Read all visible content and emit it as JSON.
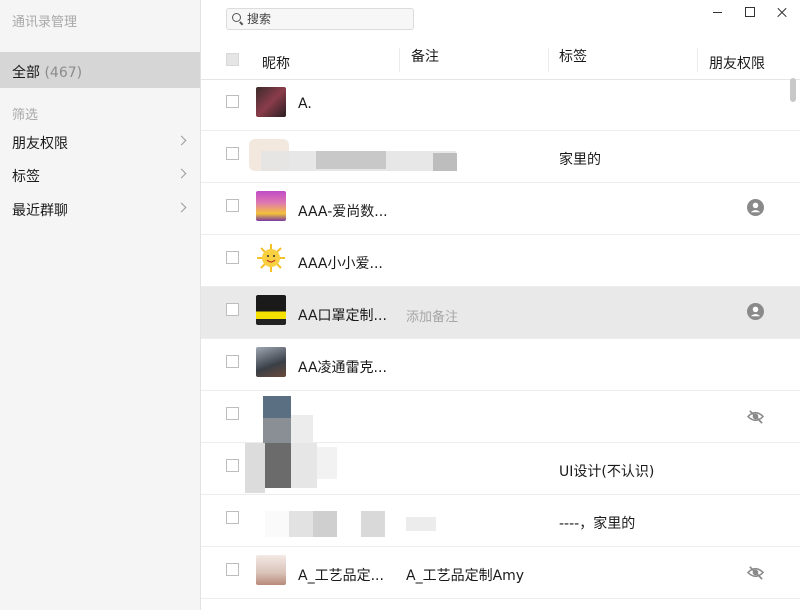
{
  "sidebar": {
    "title": "通讯录管理",
    "all_label": "全部",
    "all_count": "(467)",
    "filter_label": "筛选",
    "items": [
      {
        "label": "朋友权限"
      },
      {
        "label": "标签"
      },
      {
        "label": "最近群聊"
      }
    ]
  },
  "search": {
    "placeholder": "搜索"
  },
  "window": {
    "icons": [
      "minimize-icon",
      "maximize-icon",
      "close-icon"
    ]
  },
  "table": {
    "columns": [
      "昵称",
      "备注",
      "标签",
      "朋友权限"
    ],
    "rows": [
      {
        "nickname": "A.",
        "remark": "",
        "tags": "",
        "permission_icon": ""
      },
      {
        "nickname": "",
        "remark": "",
        "tags": "家里的",
        "permission_icon": ""
      },
      {
        "nickname": "AAA-爱尚数...",
        "remark": "",
        "tags": "",
        "permission_icon": "user-circle-icon"
      },
      {
        "nickname": "AAA小小爱...",
        "remark": "",
        "tags": "",
        "permission_icon": ""
      },
      {
        "nickname": "AA口罩定制...",
        "remark": "添加备注",
        "tags": "",
        "permission_icon": "user-circle-icon",
        "highlighted": true
      },
      {
        "nickname": "AA凌通雷克...",
        "remark": "",
        "tags": "",
        "permission_icon": ""
      },
      {
        "nickname": "",
        "remark": "",
        "tags": "",
        "permission_icon": "eye-hidden-icon"
      },
      {
        "nickname": "",
        "remark": "",
        "tags": "UI设计(不认识)",
        "permission_icon": ""
      },
      {
        "nickname": "",
        "remark": "",
        "tags": "----，家里的",
        "permission_icon": ""
      },
      {
        "nickname": "A_工艺品定...",
        "remark": "A_工艺品定制Amy",
        "tags": "",
        "permission_icon": "eye-hidden-icon"
      }
    ]
  },
  "colors": {
    "sidebar_bg": "#f5f5f5",
    "selected_bg": "#d6d6d6",
    "row_highlight": "#e9e9e9",
    "icon_gray": "#8a8a8a"
  }
}
